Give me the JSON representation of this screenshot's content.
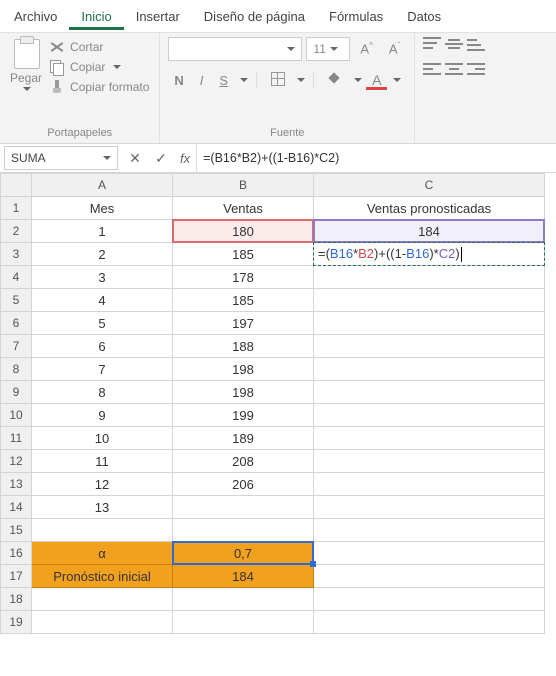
{
  "tabs": {
    "file": "Archivo",
    "home": "Inicio",
    "insert": "Insertar",
    "layout": "Diseño de página",
    "formulas": "Fórmulas",
    "data": "Datos"
  },
  "ribbon": {
    "paste": "Pegar",
    "cut": "Cortar",
    "copy": "Copiar",
    "format_painter": "Copiar formato",
    "group_clipboard": "Portapapeles",
    "group_font": "Fuente",
    "font_size": "11",
    "bold": "N",
    "italic": "I",
    "underline": "S",
    "font_color_letter": "A"
  },
  "namebox": "SUMA",
  "fx_label": "fx",
  "formula": "=(B16*B2)+((1-B16)*C2)",
  "col_headers": [
    "A",
    "B",
    "C"
  ],
  "row_headers": [
    "1",
    "2",
    "3",
    "4",
    "5",
    "6",
    "7",
    "8",
    "9",
    "10",
    "11",
    "12",
    "13",
    "14",
    "15",
    "16",
    "17",
    "18",
    "19"
  ],
  "cells": {
    "A1": "Mes",
    "B1": "Ventas",
    "C1": "Ventas pronosticadas",
    "A2": "1",
    "B2": "180",
    "C2": "184",
    "A3": "2",
    "B3": "185",
    "A4": "3",
    "B4": "178",
    "A5": "4",
    "B5": "185",
    "A6": "5",
    "B6": "197",
    "A7": "6",
    "B7": "188",
    "A8": "7",
    "B8": "198",
    "A9": "8",
    "B9": "198",
    "A10": "9",
    "B10": "199",
    "A11": "10",
    "B11": "189",
    "A12": "11",
    "B12": "208",
    "A13": "12",
    "B13": "206",
    "A14": "13",
    "A16": "α",
    "B16": "0,7",
    "A17": "Pronóstico inicial",
    "B17": "184"
  },
  "editing_formula": {
    "pre": "=(",
    "r1": "B16",
    "m1": "*",
    "r2": "B2",
    "m2": ")+((1-",
    "r3": "B16",
    "m3": ")*",
    "r4": "C2",
    "post": ")"
  }
}
